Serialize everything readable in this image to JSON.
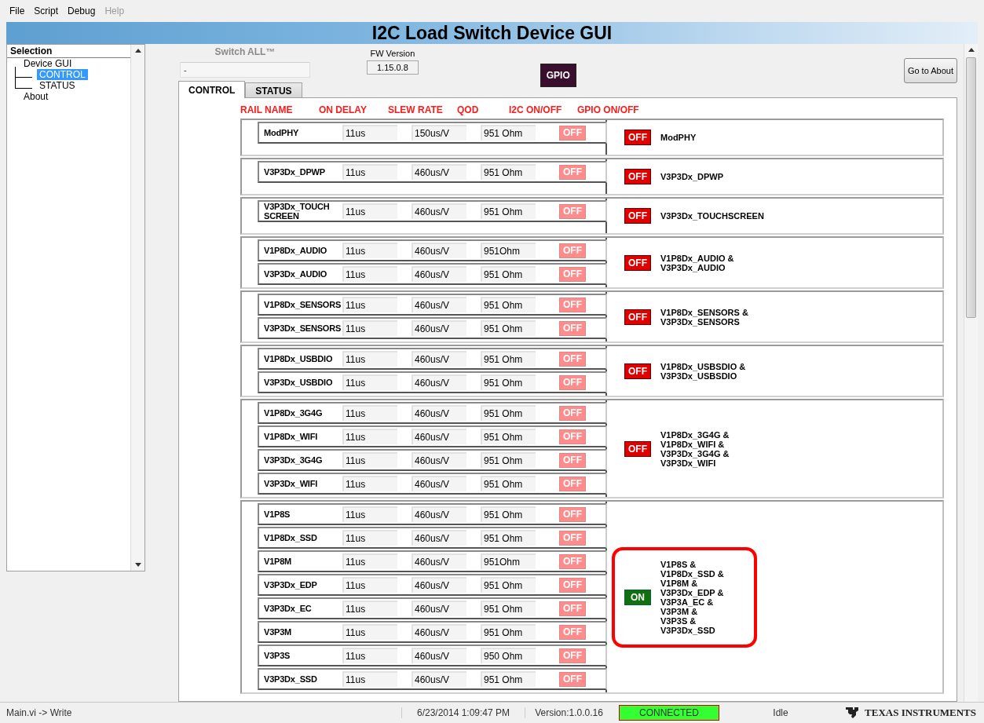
{
  "menu": [
    {
      "label": "File",
      "disabled": false
    },
    {
      "label": "Script",
      "disabled": false
    },
    {
      "label": "Debug",
      "disabled": false
    },
    {
      "label": "Help",
      "disabled": true
    }
  ],
  "title": "I2C Load Switch Device GUI",
  "tree": {
    "header": "Selection",
    "items": [
      {
        "label": "Device GUI",
        "expanded": true,
        "selected": false,
        "children": [
          {
            "label": "CONTROL",
            "selected": true
          },
          {
            "label": "STATUS",
            "selected": false
          }
        ]
      },
      {
        "label": "About",
        "selected": false
      }
    ]
  },
  "switch_all": {
    "label": "Switch ALL™",
    "disabled": true,
    "value": "-"
  },
  "fw_version": {
    "label": "FW Version",
    "value": "1.15.0.8"
  },
  "gpio_button": "GPIO",
  "about_button": "Go to About",
  "tabs": [
    {
      "label": "CONTROL",
      "selected": true
    },
    {
      "label": "STATUS",
      "selected": false
    }
  ],
  "columns": [
    "RAIL NAME",
    "ON DELAY",
    "SLEW RATE",
    "QOD",
    "I2C ON/OFF",
    "GPIO ON/OFF"
  ],
  "groups": [
    {
      "highlighted": false,
      "rows": [
        {
          "name": "ModPHY",
          "on_delay": "11us",
          "slew_rate": "150us/V",
          "qod": "951 Ohm",
          "i2c": {
            "label": "OFF",
            "on": false
          }
        }
      ],
      "gpio": {
        "label": "OFF",
        "on": false,
        "caption": [
          "ModPHY"
        ]
      }
    },
    {
      "highlighted": false,
      "rows": [
        {
          "name": "V3P3Dx_DPWP",
          "on_delay": "11us",
          "slew_rate": "460us/V",
          "qod": "951 Ohm",
          "i2c": {
            "label": "OFF",
            "on": false
          }
        }
      ],
      "gpio": {
        "label": "OFF",
        "on": false,
        "caption": [
          "V3P3Dx_DPWP"
        ]
      }
    },
    {
      "highlighted": false,
      "rows": [
        {
          "name": "V3P3Dx_TOUCH SCREEN",
          "on_delay": "11us",
          "slew_rate": "460us/V",
          "qod": "951 Ohm",
          "i2c": {
            "label": "OFF",
            "on": false
          }
        }
      ],
      "gpio": {
        "label": "OFF",
        "on": false,
        "caption": [
          "V3P3Dx_TOUCHSCREEN"
        ]
      }
    },
    {
      "highlighted": false,
      "rows": [
        {
          "name": "V1P8Dx_AUDIO",
          "on_delay": "11us",
          "slew_rate": "460us/V",
          "qod": "951Ohm",
          "i2c": {
            "label": "OFF",
            "on": false
          }
        },
        {
          "name": "V3P3Dx_AUDIO",
          "on_delay": "11us",
          "slew_rate": "460us/V",
          "qod": "951 Ohm",
          "i2c": {
            "label": "OFF",
            "on": false
          }
        }
      ],
      "gpio": {
        "label": "OFF",
        "on": false,
        "caption": [
          "V1P8Dx_AUDIO &",
          "V3P3Dx_AUDIO"
        ]
      }
    },
    {
      "highlighted": false,
      "rows": [
        {
          "name": "V1P8Dx_SENSORS",
          "on_delay": "11us",
          "slew_rate": "460us/V",
          "qod": "951 Ohm",
          "i2c": {
            "label": "OFF",
            "on": false
          }
        },
        {
          "name": "V3P3Dx_SENSORS",
          "on_delay": "11us",
          "slew_rate": "460us/V",
          "qod": "951 Ohm",
          "i2c": {
            "label": "OFF",
            "on": false
          }
        }
      ],
      "gpio": {
        "label": "OFF",
        "on": false,
        "caption": [
          "V1P8Dx_SENSORS &",
          "V3P3Dx_SENSORS"
        ]
      }
    },
    {
      "highlighted": false,
      "rows": [
        {
          "name": "V1P8Dx_USBDIO",
          "on_delay": "11us",
          "slew_rate": "460us/V",
          "qod": "951 Ohm",
          "i2c": {
            "label": "OFF",
            "on": false
          }
        },
        {
          "name": "V3P3Dx_USBDIO",
          "on_delay": "11us",
          "slew_rate": "460us/V",
          "qod": "951 Ohm",
          "i2c": {
            "label": "OFF",
            "on": false
          }
        }
      ],
      "gpio": {
        "label": "OFF",
        "on": false,
        "caption": [
          "V1P8Dx_USBSDIO &",
          "V3P3Dx_USBSDIO"
        ]
      }
    },
    {
      "highlighted": false,
      "rows": [
        {
          "name": "V1P8Dx_3G4G",
          "on_delay": "11us",
          "slew_rate": "460us/V",
          "qod": "951 Ohm",
          "i2c": {
            "label": "OFF",
            "on": false
          }
        },
        {
          "name": "V1P8Dx_WIFI",
          "on_delay": "11us",
          "slew_rate": "460us/V",
          "qod": "951 Ohm",
          "i2c": {
            "label": "OFF",
            "on": false
          }
        },
        {
          "name": "V3P3Dx_3G4G",
          "on_delay": "11us",
          "slew_rate": "460us/V",
          "qod": "951 Ohm",
          "i2c": {
            "label": "OFF",
            "on": false
          }
        },
        {
          "name": "V3P3Dx_WIFI",
          "on_delay": "11us",
          "slew_rate": "460us/V",
          "qod": "951 Ohm",
          "i2c": {
            "label": "OFF",
            "on": false
          }
        }
      ],
      "gpio": {
        "label": "OFF",
        "on": false,
        "caption": [
          "V1P8Dx_3G4G &",
          "V1P8Dx_WIFI &",
          "V3P3Dx_3G4G &",
          "V3P3Dx_WIFI"
        ]
      }
    },
    {
      "highlighted": true,
      "rows": [
        {
          "name": "V1P8S",
          "on_delay": "11us",
          "slew_rate": "460us/V",
          "qod": "951 Ohm",
          "i2c": {
            "label": "OFF",
            "on": false
          }
        },
        {
          "name": "V1P8Dx_SSD",
          "on_delay": "11us",
          "slew_rate": "460us/V",
          "qod": "951 Ohm",
          "i2c": {
            "label": "OFF",
            "on": false
          }
        },
        {
          "name": "V1P8M",
          "on_delay": "11us",
          "slew_rate": "460us/V",
          "qod": "951Ohm",
          "i2c": {
            "label": "OFF",
            "on": false
          }
        },
        {
          "name": "V3P3Dx_EDP",
          "on_delay": "11us",
          "slew_rate": "460us/V",
          "qod": "951 Ohm",
          "i2c": {
            "label": "OFF",
            "on": false
          }
        },
        {
          "name": "V3P3Dx_EC",
          "on_delay": "11us",
          "slew_rate": "460us/V",
          "qod": "951 Ohm",
          "i2c": {
            "label": "OFF",
            "on": false
          }
        },
        {
          "name": "V3P3M",
          "on_delay": "11us",
          "slew_rate": "460us/V",
          "qod": "951 Ohm",
          "i2c": {
            "label": "OFF",
            "on": false
          }
        },
        {
          "name": "V3P3S",
          "on_delay": "11us",
          "slew_rate": "460us/V",
          "qod": "950 Ohm",
          "i2c": {
            "label": "OFF",
            "on": false
          }
        },
        {
          "name": "V3P3Dx_SSD",
          "on_delay": "11us",
          "slew_rate": "460us/V",
          "qod": "951 Ohm",
          "i2c": {
            "label": "OFF",
            "on": false
          }
        }
      ],
      "gpio": {
        "label": "ON",
        "on": true,
        "caption": [
          "V1P8S &",
          "V1P8Dx_SSD &",
          "V1P8M &",
          "V3P3Dx_EDP &",
          "V3P3A_EC &",
          "V3P3M &",
          "V3P3S &",
          "V3P3Dx_SSD"
        ]
      }
    }
  ],
  "status_bar": {
    "path": "Main.vi -> Write",
    "datetime": "6/23/2014 1:09:47 PM",
    "version": "Version:1.0.0.16",
    "connection": "CONNECTED",
    "connected": true,
    "state": "Idle",
    "logo": "TEXAS INSTRUMENTS"
  }
}
